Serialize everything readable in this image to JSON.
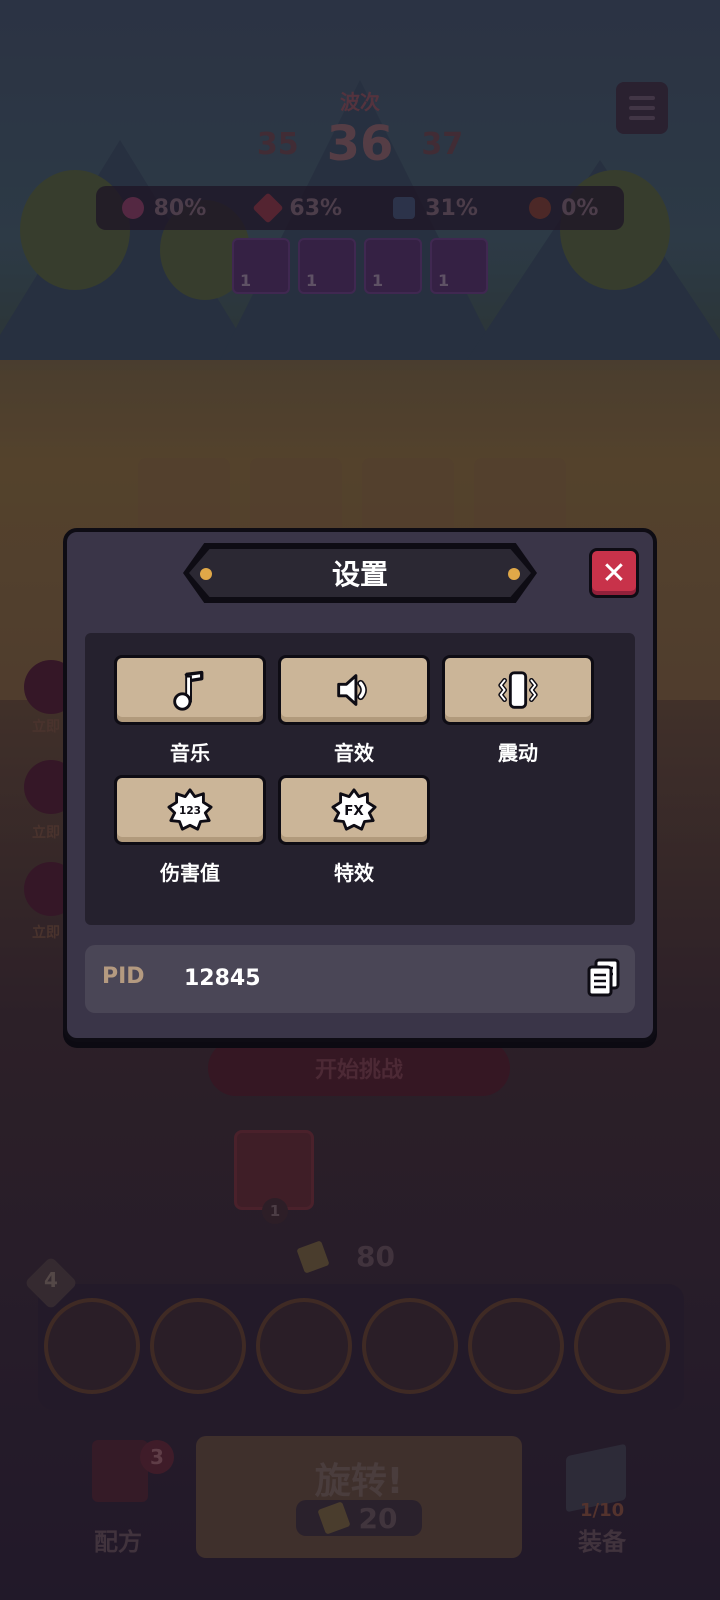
{
  "hud": {
    "wave_label": "波次",
    "wave_prev": "35",
    "wave_current": "36",
    "wave_next": "37",
    "stats": [
      {
        "icon": "heart-icon",
        "value": "80%",
        "color": "#8a3a5a"
      },
      {
        "icon": "sword-icon",
        "value": "63%",
        "color": "#8a3a4a"
      },
      {
        "icon": "shield-broken-icon",
        "value": "31%",
        "color": "#4a5a7a"
      },
      {
        "icon": "gear-burst-icon",
        "value": "0%",
        "color": "#8a4a3a"
      }
    ],
    "top_cards": [
      "1",
      "1",
      "1",
      "1"
    ]
  },
  "game": {
    "start_challenge": "开始挑战",
    "hero_card_count": "1",
    "coins": "80",
    "level": "4",
    "left_hero_label": "立即",
    "recipe_label": "配方",
    "recipe_badge": "3",
    "spin_label": "旋转!",
    "spin_cost": "20",
    "equip_label": "装备",
    "equip_count": "1/10"
  },
  "settings": {
    "title": "设置",
    "close_symbol": "✕",
    "options": [
      {
        "id": "music",
        "label": "音乐",
        "icon": "music-note-icon"
      },
      {
        "id": "sfx",
        "label": "音效",
        "icon": "speaker-icon"
      },
      {
        "id": "vibration",
        "label": "震动",
        "icon": "vibration-icon"
      },
      {
        "id": "damage",
        "label": "伤害值",
        "icon": "damage-number-icon",
        "badge": "123"
      },
      {
        "id": "effects",
        "label": "特效",
        "icon": "fx-icon",
        "badge": "FX"
      }
    ],
    "pid_label": "PID",
    "pid_value": "12845"
  },
  "colors": {
    "modal_bg": "#3a3548",
    "option_button": "#cbb598",
    "close_button": "#c8324a",
    "title_dot": "#e0a848"
  }
}
